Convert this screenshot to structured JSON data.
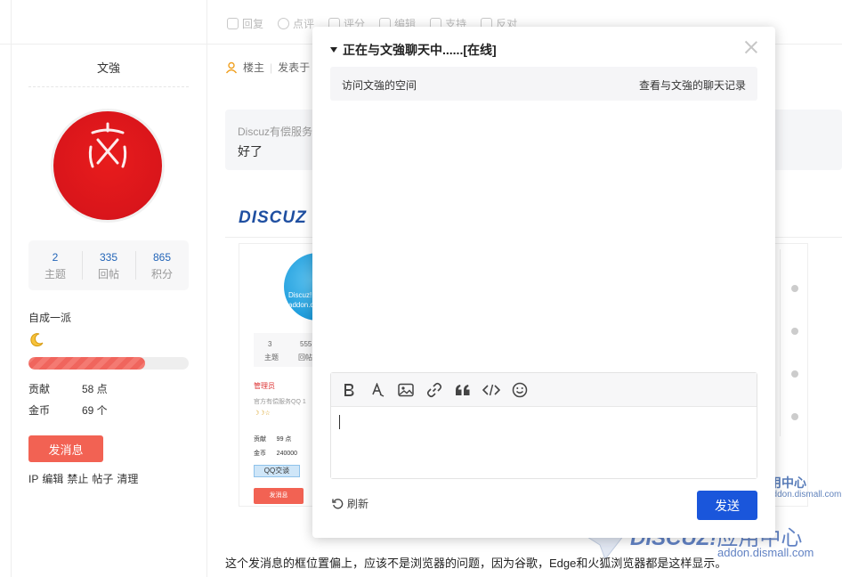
{
  "post_actions": [
    "回复",
    "点评",
    "评分",
    "编辑",
    "支持",
    "反对"
  ],
  "user": {
    "name": "文強",
    "stats": [
      {
        "num": "2",
        "label": "主题"
      },
      {
        "num": "335",
        "label": "回帖"
      },
      {
        "num": "865",
        "label": "积分"
      }
    ],
    "group": "自成一派",
    "level_progress": 0.73,
    "contribution_label": "贡献",
    "contribution_value": "58 点",
    "coins_label": "金币",
    "coins_value": "69 个",
    "send_message": "发消息",
    "admin_links": [
      "IP",
      "编辑",
      "禁止",
      "帖子",
      "清理"
    ]
  },
  "post": {
    "role": "楼主",
    "posted_prefix": "发表于",
    "quote_source": "Discuz有偿服务",
    "quote_text": "好了",
    "logo_text": "DISCUZ",
    "body_text": "这个发消息的框位置偏上，应该不是浏览器的问题，因为谷歌，Edge和火狐浏览器都是这样显示。",
    "mini": {
      "avatar_text": "Discuz! 应用",
      "avatar_text2": "addon.dism",
      "stat1_num": "3",
      "stat1_label": "主题",
      "stat2_num": "555",
      "stat2_label": "回帖",
      "role": "管理员",
      "desc": "官方有偿服务QQ 1",
      "contrib": "贡献",
      "contrib_val": "99 点",
      "coin": "金币",
      "coin_val": "240000",
      "qq": "QQ交谈",
      "send": "发消息"
    }
  },
  "watermark": {
    "small_title": "应用中心",
    "small_url": "addon.dismall.com",
    "big_brand": "DISCUZ!",
    "big_cn": "应用中心",
    "big_url": "addon.dismall.com"
  },
  "dialog": {
    "title": "正在与文強聊天中......[在线]",
    "visit_space": "访问文強的空间",
    "view_history": "查看与文強的聊天记录",
    "refresh": "刷新",
    "send": "发送",
    "input_value": ""
  },
  "colors": {
    "accent_blue": "#1a56db",
    "send_red": "#f26253",
    "stat_blue": "#2365b8",
    "avatar_red": "#d9151b"
  }
}
